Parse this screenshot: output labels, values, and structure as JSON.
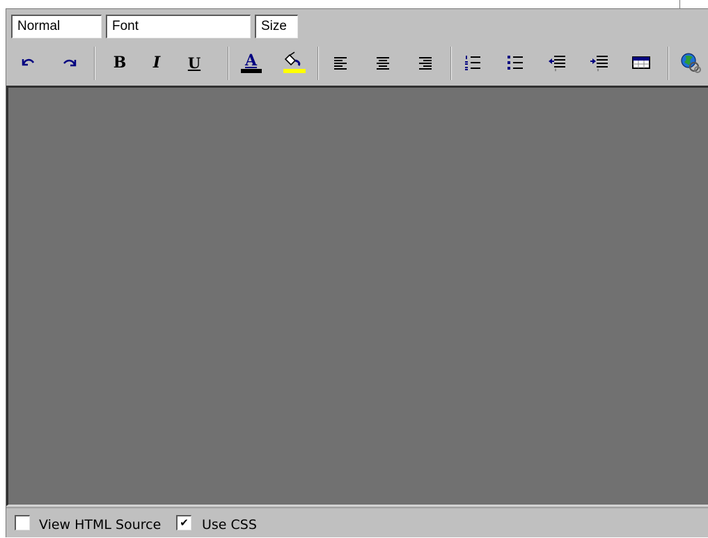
{
  "toolbar": {
    "format_select": {
      "value": "Normal"
    },
    "font_select": {
      "value": "Font"
    },
    "size_select": {
      "value": "Size"
    },
    "buttons": [
      {
        "name": "undo",
        "icon": "undo-icon"
      },
      {
        "name": "redo",
        "icon": "redo-icon"
      },
      {
        "name": "bold",
        "icon": "bold-icon",
        "glyph": "B"
      },
      {
        "name": "italic",
        "icon": "italic-icon",
        "glyph": "I"
      },
      {
        "name": "underline",
        "icon": "underline-icon",
        "glyph": "U"
      },
      {
        "name": "text-color",
        "icon": "text-color-icon",
        "glyph": "A"
      },
      {
        "name": "highlight-color",
        "icon": "paint-bucket-icon"
      },
      {
        "name": "align-left",
        "icon": "align-left-icon"
      },
      {
        "name": "align-center",
        "icon": "align-center-icon"
      },
      {
        "name": "align-right",
        "icon": "align-right-icon"
      },
      {
        "name": "ordered-list",
        "icon": "ordered-list-icon"
      },
      {
        "name": "unordered-list",
        "icon": "unordered-list-icon"
      },
      {
        "name": "outdent",
        "icon": "outdent-icon"
      },
      {
        "name": "indent",
        "icon": "indent-icon"
      },
      {
        "name": "insert-table",
        "icon": "table-icon"
      },
      {
        "name": "insert-link",
        "icon": "globe-link-icon"
      }
    ]
  },
  "colors": {
    "toolbar_bg": "#c0c0c0",
    "content_bg": "#717171",
    "icon_blue": "#000080",
    "text_color_bar": "#000000",
    "highlight_bar": "#ffff00"
  },
  "footer": {
    "view_source": {
      "label": "View HTML Source",
      "checked": false
    },
    "use_css": {
      "label": "Use CSS",
      "checked": true,
      "check_glyph": "✔"
    }
  }
}
